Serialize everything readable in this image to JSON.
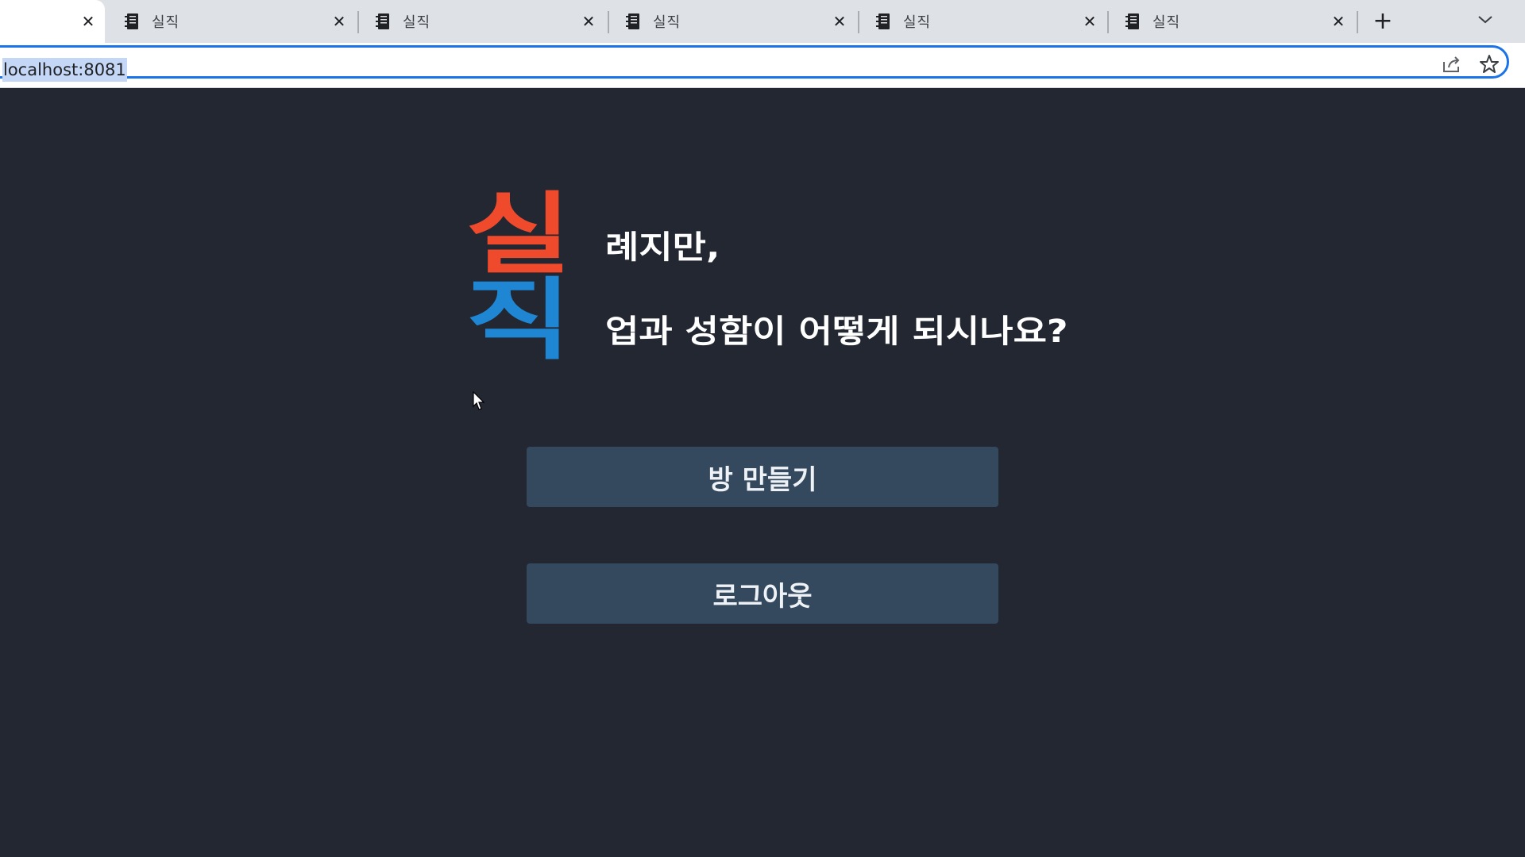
{
  "browser": {
    "tabs": [
      {
        "title": "",
        "active": true
      },
      {
        "title": "실직",
        "active": false
      },
      {
        "title": "실직",
        "active": false
      },
      {
        "title": "실직",
        "active": false
      },
      {
        "title": "실직",
        "active": false
      },
      {
        "title": "실직",
        "active": false
      }
    ],
    "url": "localhost:8081",
    "accent_color": "#1a73e8"
  },
  "page": {
    "headline": {
      "char1": "실",
      "line1": "례지만,",
      "char2": "직",
      "line2": "업과 성함이 어떻게 되시나요?",
      "color1": "#f04a2c",
      "color2": "#1f86d4"
    },
    "buttons": {
      "create_room": "방 만들기",
      "logout": "로그아웃"
    }
  }
}
